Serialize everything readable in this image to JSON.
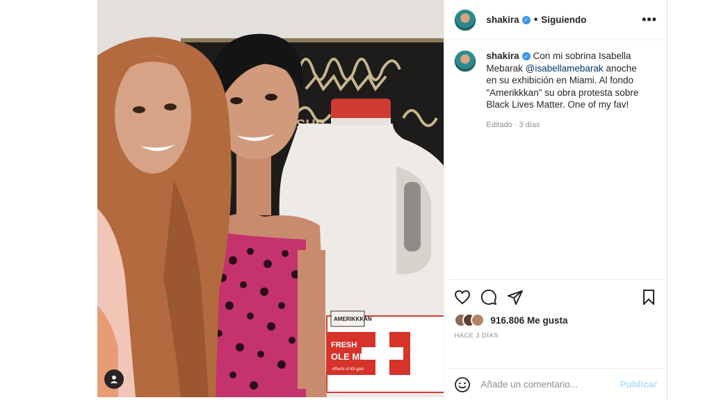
{
  "header": {
    "username": "shakira",
    "follow_label": "Siguiendo",
    "more_label": "•••"
  },
  "caption": {
    "username": "shakira",
    "text_before": " Con mi sobrina Isabella Mebarak ",
    "mention": "@isabellamebarak",
    "text_after": " anoche en su exhibición en Miami. Al fondo \"Amerikkkan\" su obra protesta sobre Black Lives Matter. One of my fav!",
    "meta": "Editado · 3 días"
  },
  "likes": {
    "text": "916.806 Me gusta",
    "time": "HACE 3 DÍAS"
  },
  "comment": {
    "placeholder": "Añade un comentario...",
    "publish_label": "Publicar"
  },
  "photo": {
    "artwork_text_top": "AMERIKKKAN",
    "label_fresh": "FRESH",
    "label_milk": "OLE MILK",
    "label_small": "effects of €5 gas!"
  }
}
